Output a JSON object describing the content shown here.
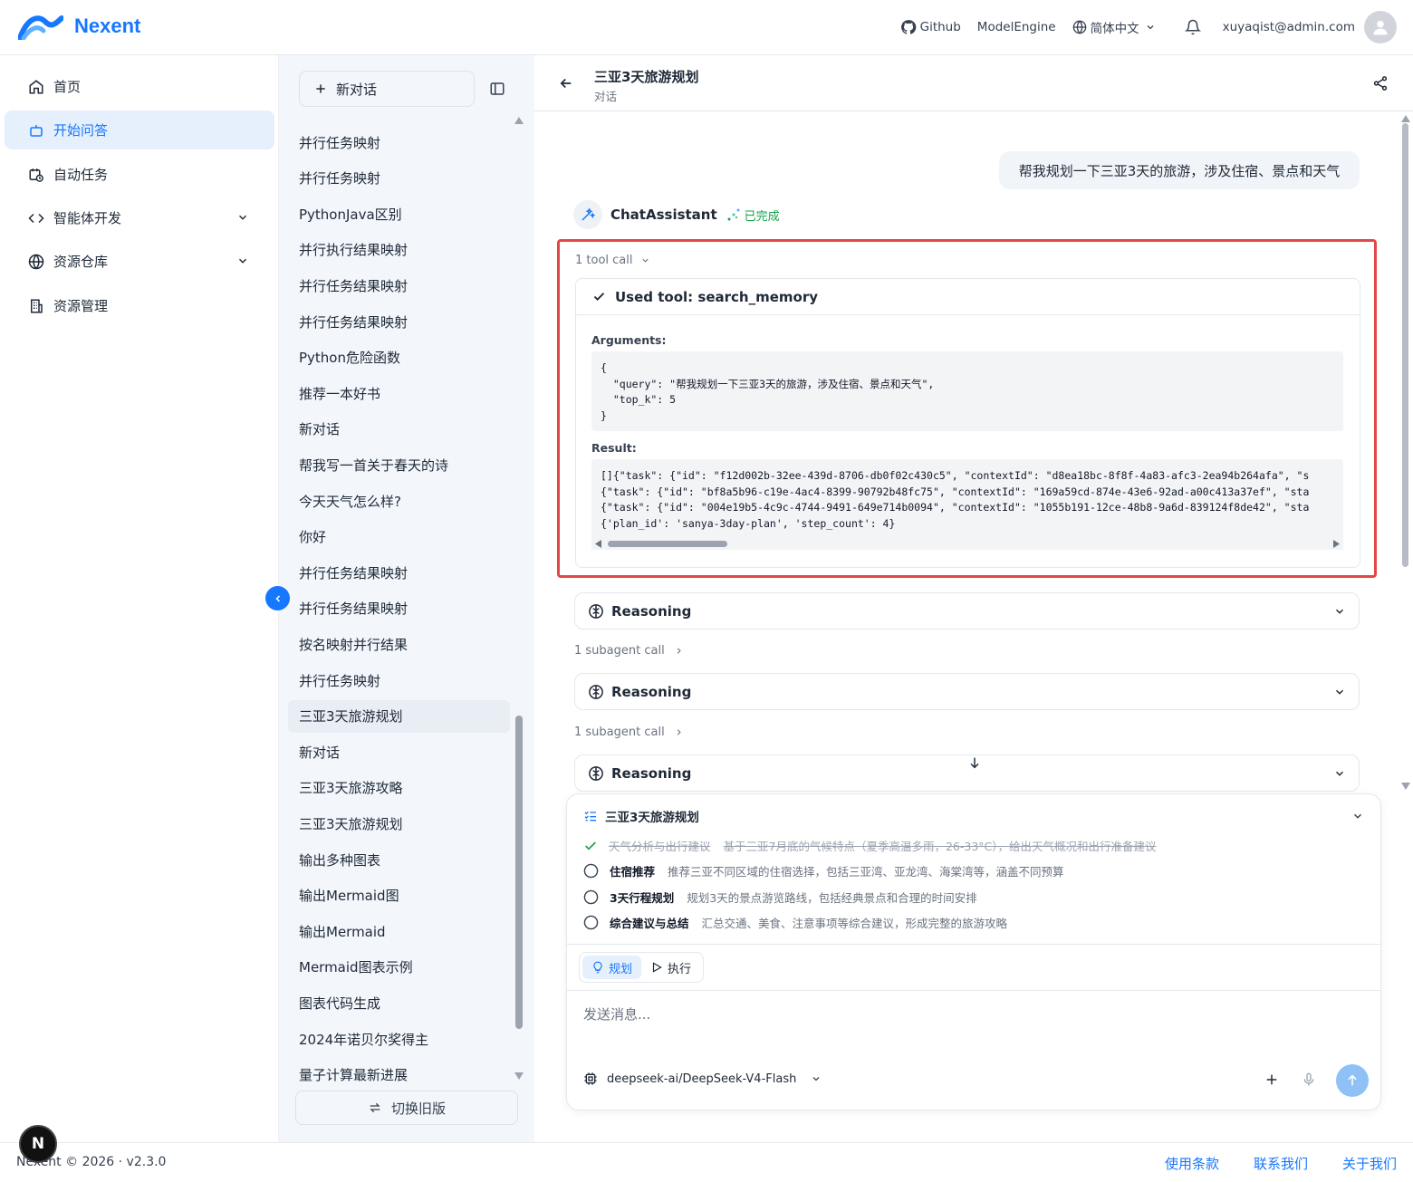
{
  "app": {
    "name": "Nexent"
  },
  "topbar": {
    "github": "Github",
    "model_engine": "ModelEngine",
    "language": "简体中文",
    "user_email": "xuyaqist@admin.com"
  },
  "nav": {
    "items": [
      {
        "label": "首页",
        "icon": "home-icon"
      },
      {
        "label": "开始问答",
        "icon": "bot-icon",
        "active": true
      },
      {
        "label": "自动任务",
        "icon": "calendar-clock-icon"
      },
      {
        "label": "智能体开发",
        "icon": "code-icon",
        "expandable": true
      },
      {
        "label": "资源仓库",
        "icon": "globe-icon",
        "expandable": true
      },
      {
        "label": "资源管理",
        "icon": "building-icon"
      }
    ]
  },
  "history": {
    "new_chat": "新对话",
    "items": [
      "并行任务映射",
      "并行任务映射",
      "PythonJava区别",
      "并行执行结果映射",
      "并行任务结果映射",
      "并行任务结果映射",
      "Python危险函数",
      "推荐一本好书",
      "新对话",
      "帮我写一首关于春天的诗",
      "今天天气怎么样?",
      "你好",
      "并行任务结果映射",
      "并行任务结果映射",
      "按名映射并行结果",
      "并行任务映射",
      "三亚3天旅游规划",
      "新对话",
      "三亚3天旅游攻略",
      "三亚3天旅游规划",
      "输出多种图表",
      "输出Mermaid图",
      "输出Mermaid",
      "Mermaid图表示例",
      "图表代码生成",
      "2024年诺贝尔奖得主",
      "量子计算最新进展"
    ],
    "selected_index": 16,
    "switch_old": "切换旧版"
  },
  "conversation": {
    "title": "三亚3天旅游规划",
    "subtitle": "对话",
    "user_message": "帮我规划一下三亚3天的旅游，涉及住宿、景点和天气",
    "agent_name": "ChatAssistant",
    "agent_status": "已完成",
    "tool_call_count": "1 tool call",
    "tool_used": "Used tool: search_memory",
    "arguments_label": "Arguments:",
    "arguments_code": "{\n  \"query\": \"帮我规划一下三亚3天的旅游，涉及住宿、景点和天气\",\n  \"top_k\": 5\n}",
    "result_label": "Result:",
    "result_code": "[]{\"task\": {\"id\": \"f12d002b-32ee-439d-8706-db0f02c430c5\", \"contextId\": \"d8ea18bc-8f8f-4a83-afc3-2ea94b264afa\", \"s\n{\"task\": {\"id\": \"bf8a5b96-c19e-4ac4-8399-90792b48fc75\", \"contextId\": \"169a59cd-874e-43e6-92ad-a00c413a37ef\", \"sta\n{\"task\": {\"id\": \"004e19b5-4c9c-4744-9491-649e714b0094\", \"contextId\": \"1055b191-12ce-48b8-9a6d-839124f8de42\", \"sta\n{'plan_id': 'sanya-3day-plan', 'step_count': 4}",
    "reasoning_label": "Reasoning",
    "subagent_call": "1 subagent call"
  },
  "plan": {
    "title": "三亚3天旅游规划",
    "steps": [
      {
        "name": "天气分析与出行建议",
        "desc": "基于三亚7月底的气候特点（夏季高温多雨，26-33°C），给出天气概况和出行准备建议",
        "done": true
      },
      {
        "name": "住宿推荐",
        "desc": "推荐三亚不同区域的住宿选择，包括三亚湾、亚龙湾、海棠湾等，涵盖不同预算",
        "done": false
      },
      {
        "name": "3天行程规划",
        "desc": "规划3天的景点游览路线，包括经典景点和合理的时间安排",
        "done": false
      },
      {
        "name": "综合建议与总结",
        "desc": "汇总交通、美食、注意事项等综合建议，形成完整的旅游攻略",
        "done": false
      }
    ]
  },
  "composer": {
    "mode_plan": "规划",
    "mode_execute": "执行",
    "placeholder": "发送消息...",
    "model": "deepseek-ai/DeepSeek-V4-Flash"
  },
  "footer": {
    "copyright": "Nexent © 2026 · v2.3.0",
    "terms": "使用条款",
    "contact": "联系我们",
    "about": "关于我们"
  },
  "badge": {
    "letter": "N"
  },
  "colors": {
    "accent": "#1677ff",
    "highlight_border": "#e34848",
    "done_green": "#16a34a"
  }
}
